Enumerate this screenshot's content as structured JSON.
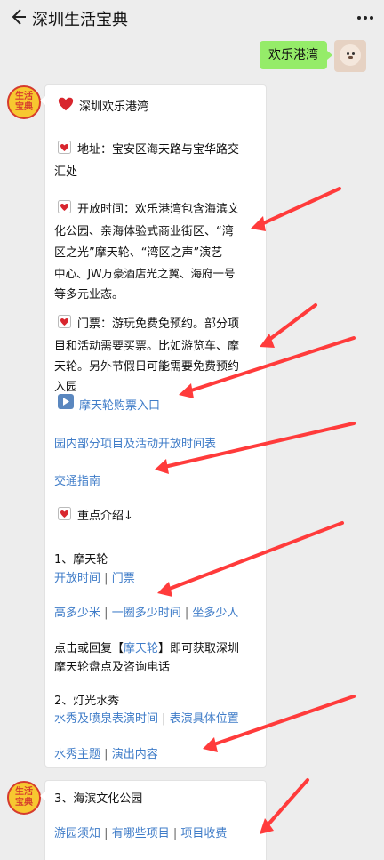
{
  "header": {
    "title": "深圳生活宝典"
  },
  "user": {
    "message": "欢乐港湾"
  },
  "bot_avatar_text": {
    "top": "生活",
    "bottom": "宝典"
  },
  "message1": {
    "title": "深圳欢乐港湾",
    "address_1": "地址：宝安区海天路与宝华路交",
    "address_2": "汇处",
    "hours_1": "开放时间：欢乐港湾包含海滨文",
    "hours_2": "化公园、亲海体验式商业街区、“湾",
    "hours_3": "区之光”摩天轮、“湾区之声”演艺",
    "hours_4": "中心、JW万豪酒店光之翼、海府一号",
    "hours_5": "等多元业态。",
    "ticket_1": "门票：游玩免费免预约。部分项",
    "ticket_2": "目和活动需要买票。比如游览车、摩",
    "ticket_3": "天轮。另外节假日可能需要免费预约",
    "ticket_4": "入园",
    "ferris_ticket_link": "摩天轮购票入口",
    "schedule_link": "园内部分项目及活动开放时间表",
    "transport_link": "交通指南",
    "highlights_title": "重点介绍↓",
    "section1_title": "1、摩天轮",
    "ferris_links_a": [
      "开放时间",
      "门票"
    ],
    "ferris_links_b": [
      "高多少米",
      "一圈多少时间",
      "坐多少人"
    ],
    "reply_1a": "点击或回复【",
    "reply_1b": "摩天轮",
    "reply_1c": "】即可获取深圳",
    "reply_2": "摩天轮盘点及咨询电话",
    "section2_title": "2、灯光水秀",
    "show_links_a": [
      "水秀及喷泉表演时间",
      "表演具体位置"
    ],
    "show_links_b": [
      "水秀主题",
      "演出内容"
    ],
    "divider": "|"
  },
  "message2": {
    "section3_title": "3、海滨文化公园",
    "park_links": [
      "游园须知",
      "有哪些项目",
      "项目收费"
    ]
  },
  "colors": {
    "link": "#3f7cc8",
    "user_bubble": "#95ec69",
    "arrow": "#ff3b3b"
  }
}
